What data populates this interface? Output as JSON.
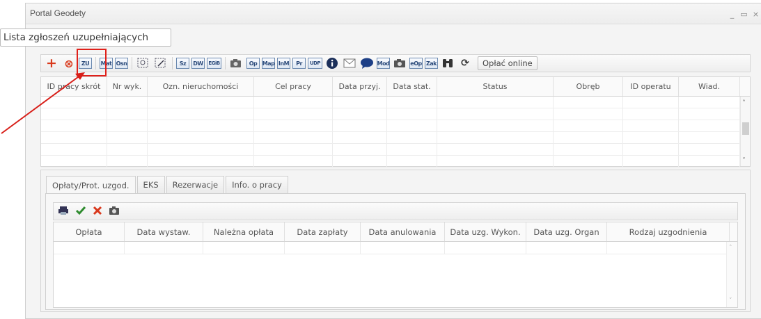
{
  "window": {
    "title": "Portal Geodety",
    "controls": [
      "_",
      "▭",
      "×"
    ]
  },
  "tooltip": {
    "text": "Lista zgłoszeń uzupełniających"
  },
  "toolbar": {
    "buttons": [
      {
        "name": "add-icon",
        "glyph": "+"
      },
      {
        "name": "cancel-icon",
        "glyph": "⊗"
      },
      {
        "name": "zu-button",
        "label": "ZU"
      },
      {
        "name": "mat-button",
        "label": "Mat"
      },
      {
        "name": "osn-button",
        "label": "Osn"
      },
      {
        "name": "zoom-area-icon",
        "glyph": "⬚"
      },
      {
        "name": "magic-wand-icon",
        "glyph": "⬚"
      },
      {
        "name": "sz-button",
        "label": "Sz"
      },
      {
        "name": "dw-button",
        "label": "DW"
      },
      {
        "name": "egib-button",
        "label": "EGiB"
      },
      {
        "name": "camera-icon",
        "glyph": "📷"
      },
      {
        "name": "op-button",
        "label": "Op"
      },
      {
        "name": "map-button",
        "label": "Map"
      },
      {
        "name": "inm-button",
        "label": "InM"
      },
      {
        "name": "pr-button",
        "label": "Pr"
      },
      {
        "name": "udp-button",
        "label": "UDP"
      },
      {
        "name": "info-icon",
        "glyph": "ℹ"
      },
      {
        "name": "mail-icon",
        "glyph": "✉"
      },
      {
        "name": "chat-icon",
        "glyph": "💬"
      },
      {
        "name": "mod-button",
        "label": "Mod"
      },
      {
        "name": "photo-icon",
        "glyph": "📷"
      },
      {
        "name": "eop-button",
        "label": "eOp"
      },
      {
        "name": "zak-button",
        "label": "Zak"
      },
      {
        "name": "binoculars-icon",
        "glyph": "🔭"
      },
      {
        "name": "refresh-icon",
        "glyph": "⟳"
      }
    ],
    "pay_online_label": "Opłać online"
  },
  "grid1": {
    "columns": [
      "ID pracy skrót",
      "Nr wyk.",
      "Ozn. nieruchomości",
      "Cel pracy",
      "Data przyj.",
      "Data stat.",
      "Status",
      "Obręb",
      "ID operatu",
      "Wiad."
    ],
    "rows": 6
  },
  "lower": {
    "tabs": [
      "Opłaty/Prot. uzgod.",
      "EKS",
      "Rezerwacje",
      "Info. o pracy"
    ],
    "active_tab": 0,
    "columns": [
      "Opłata",
      "Data wystaw.",
      "Należna opłata",
      "Data zapłaty",
      "Data anulowania",
      "Data uzg. Wykon.",
      "Data uzg. Organ",
      "Rodzaj uzgodnienia"
    ]
  },
  "colors": {
    "highlight": "#e0201a",
    "add": "#d93a1c",
    "ok": "#2e8b2e",
    "remove": "#d9381c"
  }
}
